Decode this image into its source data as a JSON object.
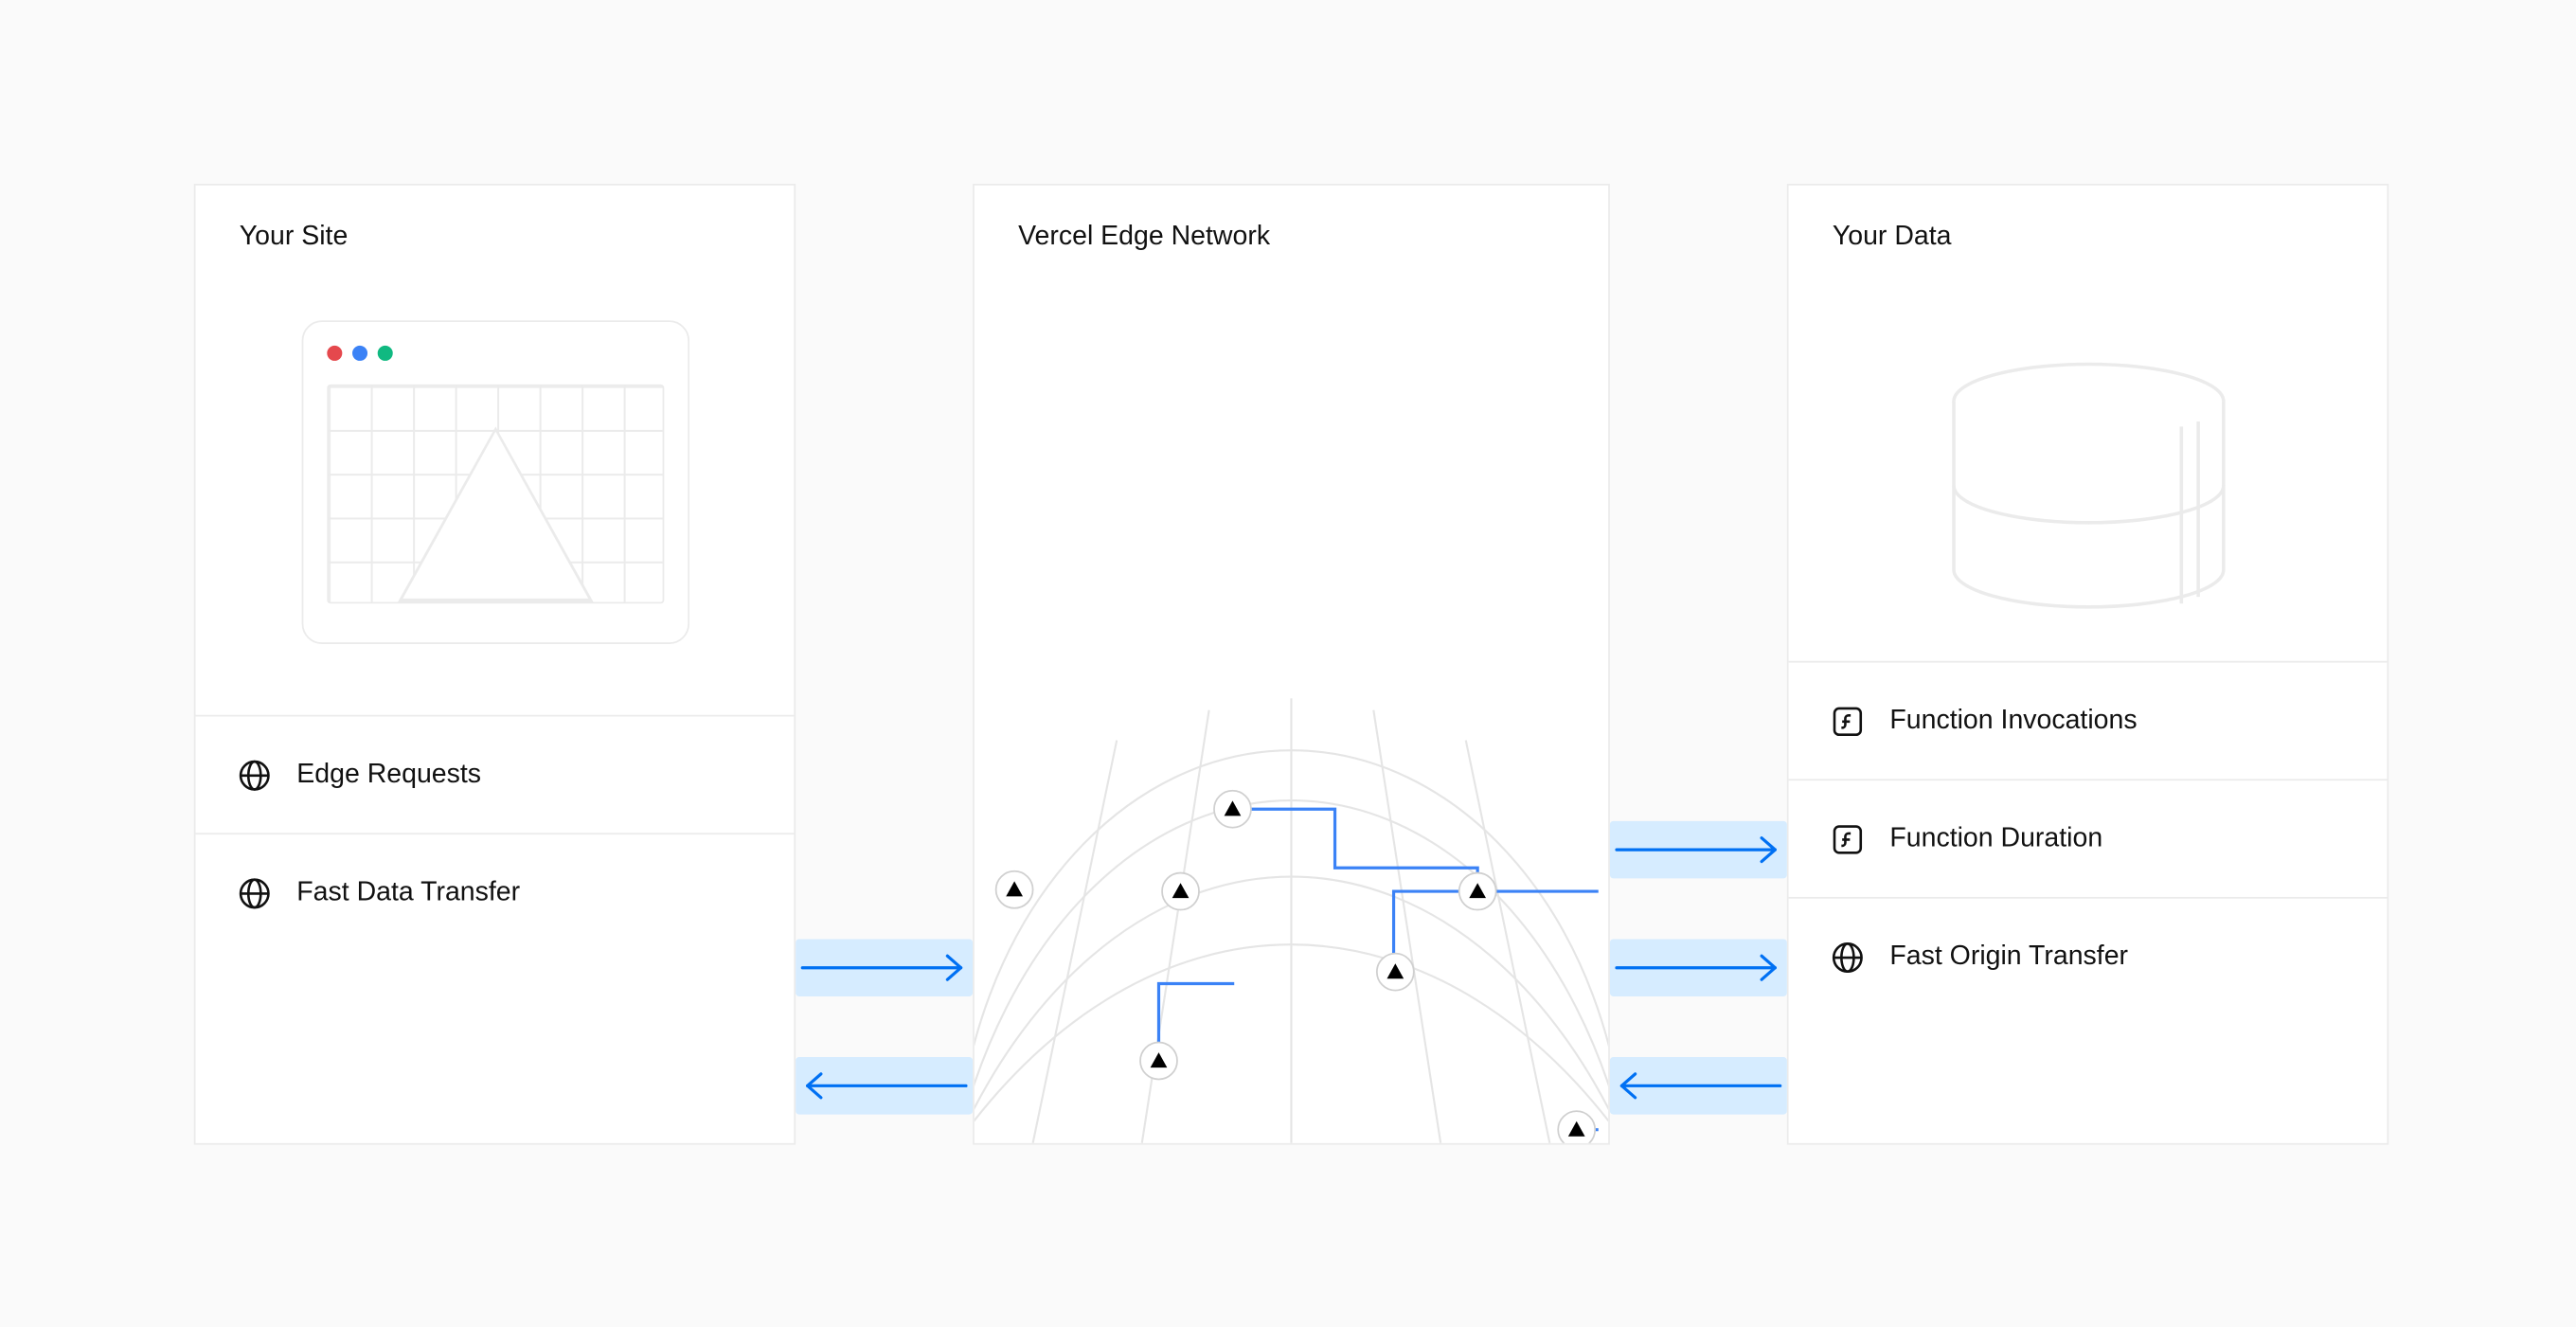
{
  "left": {
    "title": "Your Site",
    "rows": [
      {
        "icon": "globe",
        "label": "Edge Requests"
      },
      {
        "icon": "globe",
        "label": "Fast Data Transfer"
      }
    ]
  },
  "mid": {
    "title": "Vercel Edge Network"
  },
  "right": {
    "title": "Your Data",
    "rows": [
      {
        "icon": "function",
        "label": "Function Invocations"
      },
      {
        "icon": "function",
        "label": "Function Duration"
      },
      {
        "icon": "globe",
        "label": "Fast Origin Transfer"
      }
    ]
  },
  "arrows": {
    "left_to_mid": "right",
    "mid_to_left": "left",
    "mid_to_right_top": "right",
    "mid_to_right_mid": "right",
    "right_to_mid_bottom": "left"
  }
}
